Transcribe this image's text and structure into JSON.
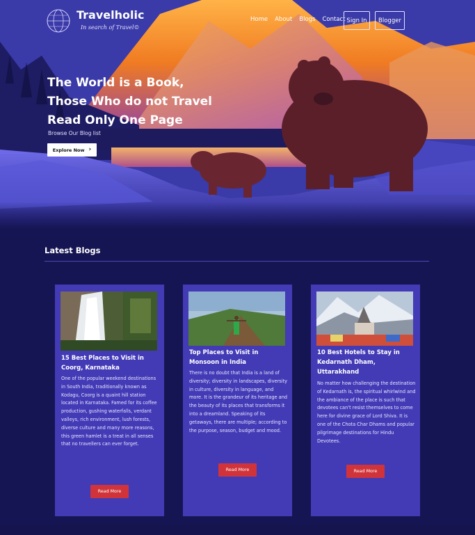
{
  "brand": {
    "name": "Travelholic",
    "tagline": "In search of Travel©"
  },
  "nav": {
    "links": [
      "Home",
      "About",
      "Blogs",
      "Contact"
    ],
    "sign_in": "Sign In",
    "blogger": "Blogger"
  },
  "hero": {
    "headline_lines": [
      "The World is a Book,",
      "Those Who do not Travel",
      "Read Only One Page"
    ],
    "subline": "Browse Our Blog list",
    "cta": "Explore Now"
  },
  "latest": {
    "title": "Latest Blogs",
    "cards": [
      {
        "title": "15 Best Places to Visit in Coorg, Karnataka",
        "body": "One of the popular weekend destinations in South India, traditionally known as Kodagu, Coorg is a quaint hill station located in Karnataka. Famed for its coffee production, gushing waterfalls, verdant valleys, rich environment, lush forests, diverse culture and many more reasons, this green hamlet is a treat in all senses that no travellers can ever forget.",
        "button": "Read More",
        "image": "waterfall-photo"
      },
      {
        "title": "Top Places to Visit in Monsoon in India",
        "body": "There is no doubt that India is a land of diversity; diversity in landscapes, diversity in culture, diversity in language, and more. It is the grandeur of its heritage and the beauty of its places that transforms it into a dreamland. Speaking of its getaways, there are multiple; according to the purpose, season, budget and mood.",
        "button": "Read More",
        "image": "monsoon-hill-photo"
      },
      {
        "title": "10 Best Hotels to Stay in Kedarnath Dham, Uttarakhand",
        "body": "No matter how challenging the destination of Kedarnath is, the spiritual whirlwind and the ambiance of the place is such that devotees can't resist themselves to come here for divine grace of Lord Shiva. It is one of the Chota Char Dhams and popular pilgrimage destinations for Hindu Devotees.",
        "button": "Read More",
        "image": "kedarnath-temple-photo"
      }
    ]
  },
  "colors": {
    "page_bg": "#161553",
    "card_bg": "#433bb6",
    "button_red": "#d0343a",
    "mountain_orange": "#f08a2a"
  }
}
